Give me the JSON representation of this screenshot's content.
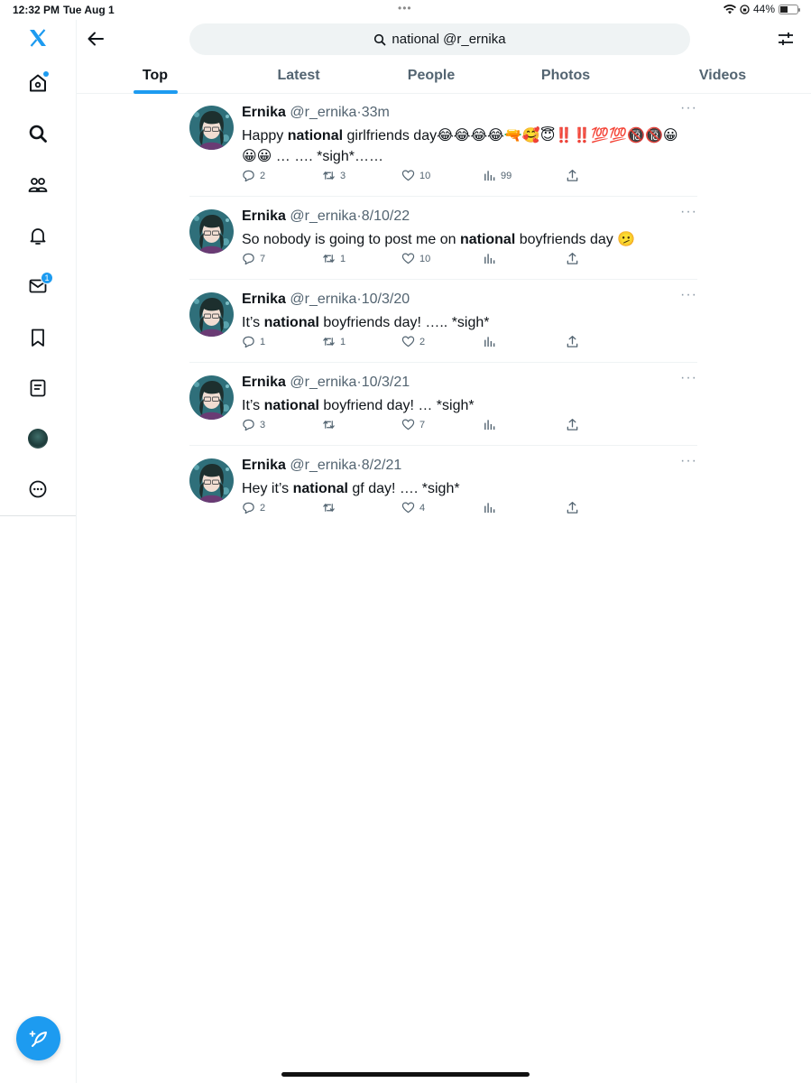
{
  "status": {
    "time": "12:32 PM",
    "date": "Tue Aug 1",
    "battery": "44%",
    "battery_level": 0.44
  },
  "search": {
    "query": "national @r_ernika"
  },
  "tabs": [
    {
      "label": "Top",
      "active": true
    },
    {
      "label": "Latest"
    },
    {
      "label": "People"
    },
    {
      "label": "Photos"
    },
    {
      "label": "Videos"
    }
  ],
  "sidebar": {
    "messages_badge": "1"
  },
  "tweets": [
    {
      "name": "Ernika",
      "handle": "@r_ernika",
      "dot": "·",
      "time": "33m",
      "pre": "Happy ",
      "bold": "national",
      "post": " girlfriends day😂😂😂😂🔫🥰😇‼️‼️💯💯🔞🔞😀😀😀 … …. *sigh*……",
      "replies": "2",
      "retweets": "3",
      "likes": "10",
      "views": "99"
    },
    {
      "name": "Ernika",
      "handle": "@r_ernika",
      "dot": "·",
      "time": "8/10/22",
      "pre": "So nobody is going to post me on ",
      "bold": "national",
      "post": " boyfriends day 🫤",
      "replies": "7",
      "retweets": "1",
      "likes": "10",
      "views": ""
    },
    {
      "name": "Ernika",
      "handle": "@r_ernika",
      "dot": "·",
      "time": "10/3/20",
      "pre": "It’s ",
      "bold": "national",
      "post": " boyfriends day! ….. *sigh*",
      "replies": "1",
      "retweets": "1",
      "likes": "2",
      "views": ""
    },
    {
      "name": "Ernika",
      "handle": "@r_ernika",
      "dot": "·",
      "time": "10/3/21",
      "pre": "It’s ",
      "bold": "national",
      "post": " boyfriend day! … *sigh*",
      "replies": "3",
      "retweets": "",
      "likes": "7",
      "views": ""
    },
    {
      "name": "Ernika",
      "handle": "@r_ernika",
      "dot": "·",
      "time": "8/2/21",
      "pre": "Hey it’s ",
      "bold": "national",
      "post": " gf day! …. *sigh*",
      "replies": "2",
      "retweets": "",
      "likes": "4",
      "views": ""
    }
  ],
  "colors": {
    "accent": "#1d9bf0",
    "text": "#0f1419",
    "secondary": "#536471"
  }
}
